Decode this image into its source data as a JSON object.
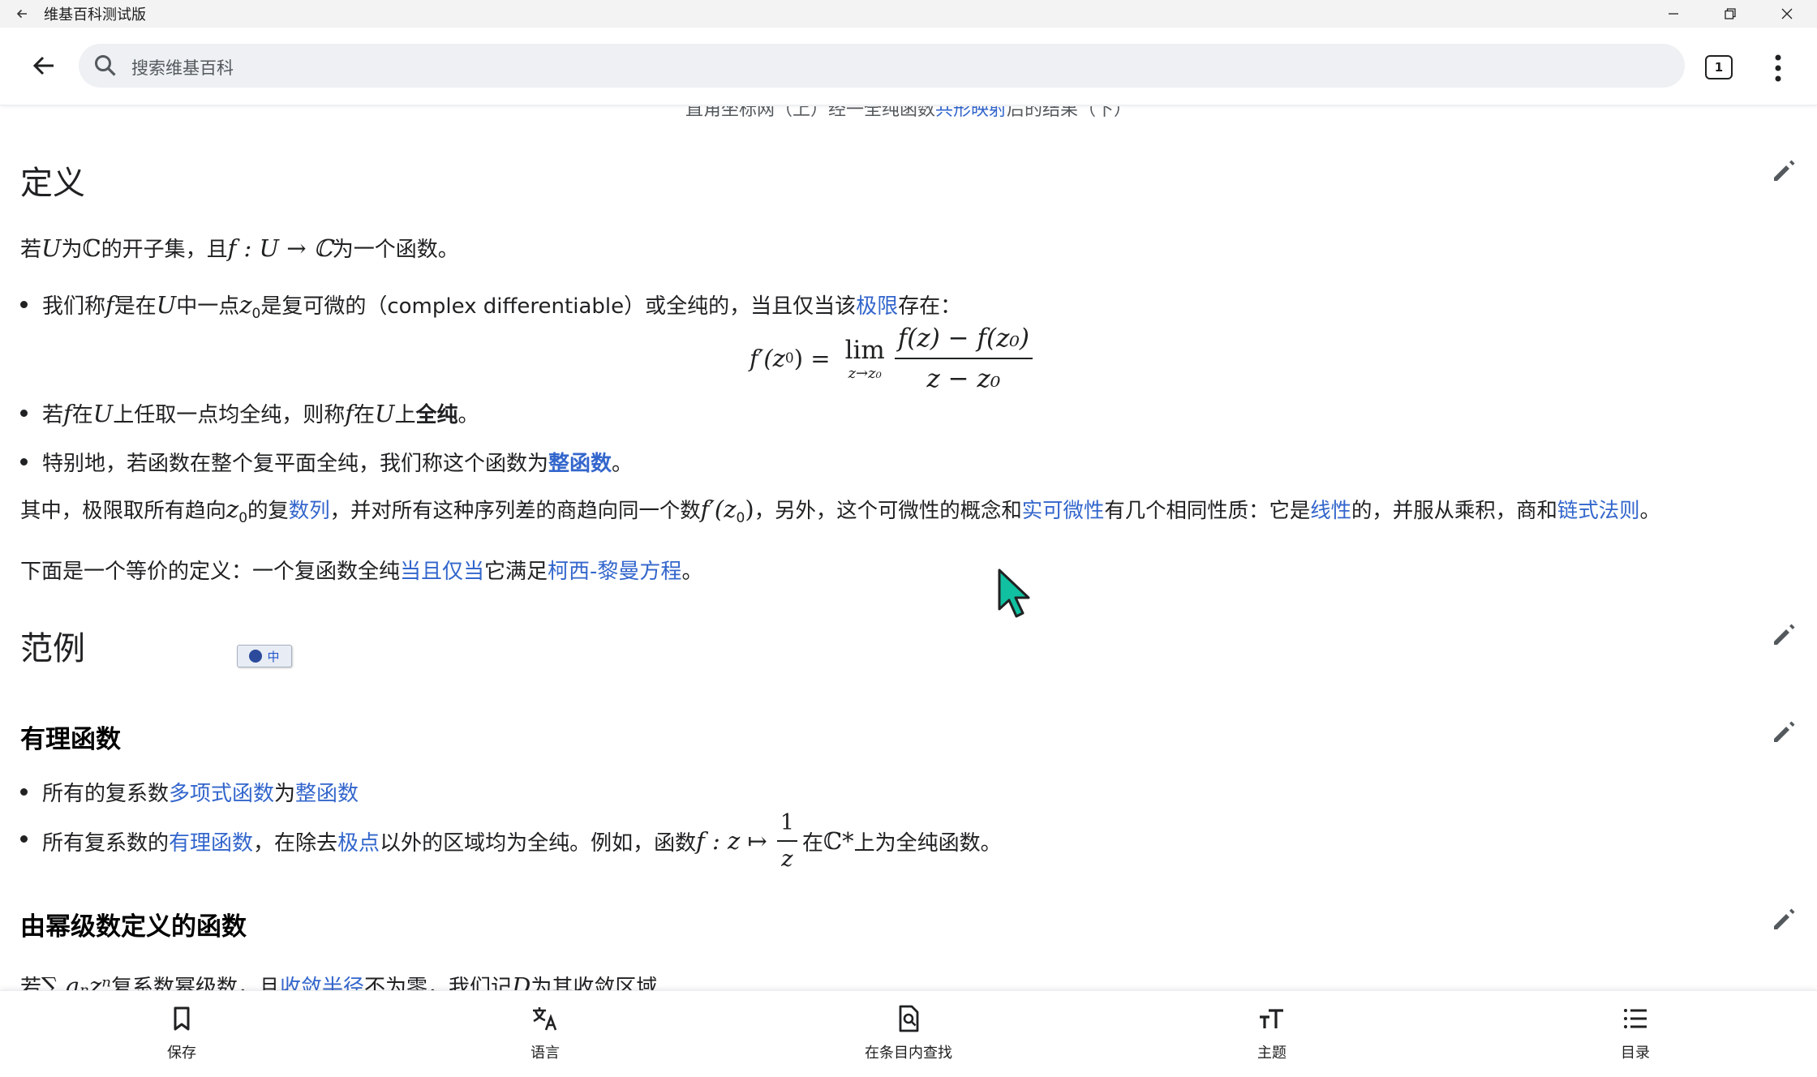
{
  "window": {
    "title": "维基百科测试版"
  },
  "search": {
    "placeholder": "搜索维基百科",
    "tab_count": "1"
  },
  "caption": {
    "before": "直角坐标网（上）经一全纯函数",
    "link": "共形映射",
    "after": "后的结果（下）"
  },
  "sections": {
    "definition": {
      "heading": "定义",
      "intro": {
        "t1": "若",
        "U": "U",
        "t2": "为",
        "C1": "ℂ",
        "t3": "的开子集，且",
        "f": "f",
        "map": " : U → ℂ",
        "t4": "为一个函数。"
      },
      "item1": {
        "t1": "我们称",
        "f": "f",
        "t2": "是在",
        "U": "U",
        "t3": "中一点",
        "z0": "z",
        "z0sub": "0",
        "t4": "是复可微的（complex differentiable）或全纯的，当且仅当该",
        "link": "极限",
        "t5": "存在："
      },
      "formula": {
        "lhs": "f′(z",
        "lhs_sub": "0",
        "lhs_end": ") =",
        "lim": "lim",
        "lim_under": "z→z₀",
        "num": "f(z) − f(z₀)",
        "den": "z − z₀"
      },
      "item2": {
        "t1": "若",
        "f": "f",
        "t2": "在",
        "U": "U",
        "t3": "上任取一点均全纯，则称",
        "f2": "f",
        "t4": "在",
        "U2": "U",
        "t5": "上",
        "bold": "全纯",
        "t6": "。"
      },
      "item3": {
        "t1": "特别地，若函数在整个复平面全纯，我们称这个函数为",
        "link": "整函数",
        "t2": "。"
      },
      "para1": {
        "t1": "其中，极限取所有趋向",
        "z": "z",
        "zsub": "0",
        "t2": "的复",
        "link1": "数列",
        "t3": "，并对所有这种序列差的商趋向同一个数",
        "fz": "f′(z",
        "fzsub": "0",
        "fzend": ")",
        "t4": "，另外，这个可微性的概念和",
        "link2": "实可微性",
        "t5": "有几个相同性质：它是",
        "link3": "线性",
        "t6": "的，并服从乘积，商和",
        "link4": "链式法则",
        "t7": "。"
      },
      "para2": {
        "t1": "下面是一个等价的定义：一个复函数全纯",
        "link1": "当且仅当",
        "t2": "它满足",
        "link2": "柯西-黎曼方程",
        "t3": "。"
      }
    },
    "examples": {
      "heading": "范例",
      "ime": "中",
      "rational": {
        "heading": "有理函数",
        "item1": {
          "t1": "所有的复系数",
          "link1": "多项式函数",
          "t2": "为",
          "link2": "整函数"
        },
        "item2": {
          "t1": "所有复系数的",
          "link1": "有理函数",
          "t2": "，在除去",
          "link2": "极点",
          "t3": "以外的区域均为全纯。例如，函数",
          "f": "f : z ↦",
          "num": "1",
          "den": "z",
          "t4": "在",
          "C": "ℂ*",
          "t5": "上为全纯函数。"
        }
      },
      "power": {
        "heading": "由幂级数定义的函数",
        "para": {
          "t1": "若",
          "sum": "∑ aₙzⁿ",
          "t2": "复系数幂级数，且",
          "link": "收敛半径",
          "t3": "不为零，我们记",
          "D": "D",
          "t4": "为其收敛区域"
        }
      }
    }
  },
  "bottom_nav": [
    {
      "label": "保存",
      "icon": "bookmark-icon"
    },
    {
      "label": "语言",
      "icon": "translate-icon"
    },
    {
      "label": "在条目内查找",
      "icon": "find-in-page-icon"
    },
    {
      "label": "主题",
      "icon": "text-size-icon"
    },
    {
      "label": "目录",
      "icon": "list-icon"
    }
  ]
}
